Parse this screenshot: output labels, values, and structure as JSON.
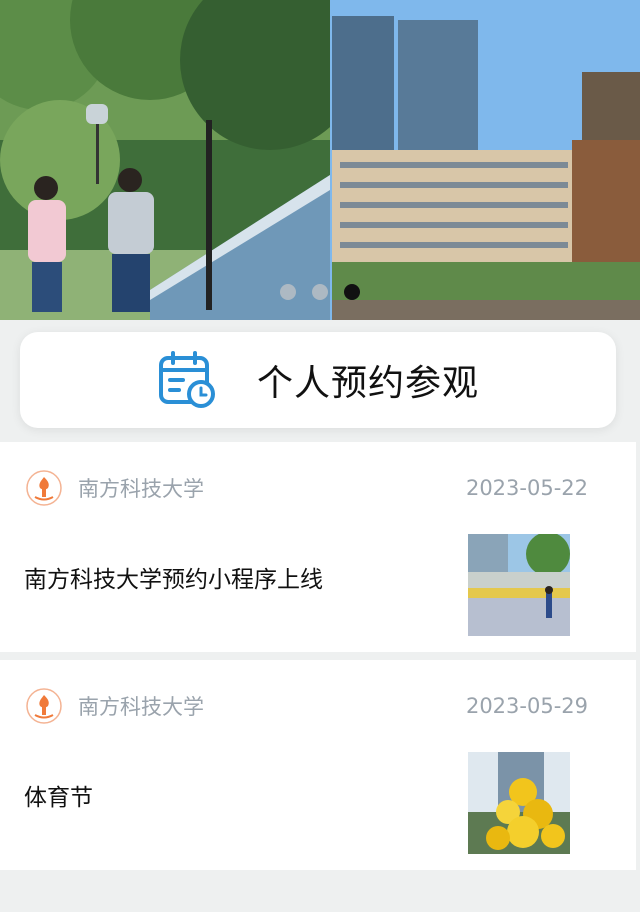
{
  "banner": {
    "slides": [
      "campus-walkway-photo",
      "campus-buildings-photo"
    ],
    "active_index": 2,
    "dot_count": 3
  },
  "action": {
    "label": "个人预约参观",
    "icon": "calendar-clock-icon",
    "icon_color": "#2a8fd6"
  },
  "news": [
    {
      "source": "南方科技大学",
      "date": "2023-05-22",
      "title": "南方科技大学预约小程序上线",
      "thumb": "campus-sign-photo"
    },
    {
      "source": "南方科技大学",
      "date": "2023-05-29",
      "title": "体育节",
      "thumb": "yellow-flowers-photo"
    }
  ],
  "colors": {
    "background": "#eef0f0",
    "meta_text": "#9aa3ac",
    "logo_orange": "#f07a3a"
  }
}
